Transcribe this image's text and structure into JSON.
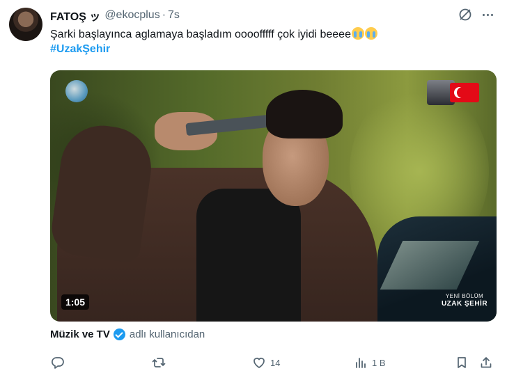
{
  "tweet": {
    "author_name": "FATOŞ ッ",
    "handle": "@ekocplus",
    "separator": "·",
    "time": "7s",
    "text": "Şarki başlayınca aglamaya başladım oooofffff çok iyidi beeee",
    "hashtag": "#UzakŞehir"
  },
  "media": {
    "duration": "1:05",
    "overlay_line1": "YENİ BÖLÜM",
    "overlay_line2": "UZAK ŞEHİR"
  },
  "credit": {
    "name": "Müzik ve TV",
    "suffix": "adlı kullanıcıdan"
  },
  "actions": {
    "reply_count": "",
    "retweet_count": "",
    "like_count": "14",
    "views_count": "1 B"
  },
  "colors": {
    "accent": "#1d9bf0",
    "secondary_text": "#536471"
  },
  "icons": [
    "reply-icon",
    "retweet-icon",
    "like-icon",
    "views-icon",
    "bookmark-icon",
    "share-icon",
    "grok-icon",
    "more-icon",
    "verified-badge-icon"
  ]
}
